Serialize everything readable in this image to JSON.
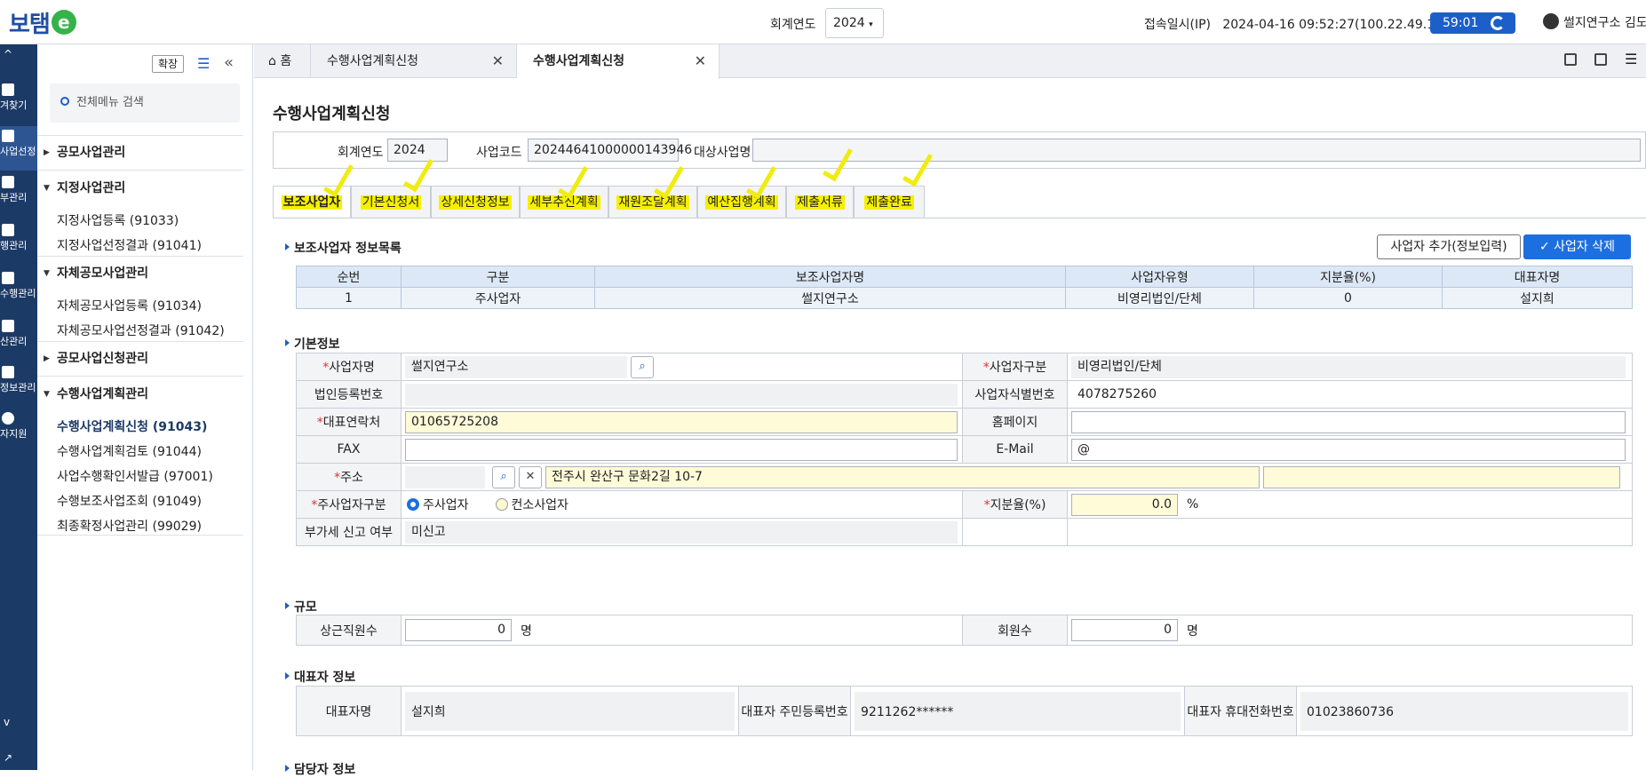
{
  "header": {
    "logo_text": "보탬",
    "logo_e": "e",
    "fiscal_year_label": "회계연도",
    "fiscal_year_value": "2024",
    "connection_info": "접속일시(IP)   2024-04-16 09:52:27(100.22.49.174)",
    "timer": "59:01",
    "user": "썰지연구소 김도"
  },
  "leftnav": {
    "items": [
      {
        "label": "겨찾기"
      },
      {
        "label": "사업선정"
      },
      {
        "label": "부관리"
      },
      {
        "label": "행관리"
      },
      {
        "label": "수행관리"
      },
      {
        "label": "산관리"
      },
      {
        "label": "정보관리"
      },
      {
        "label": "자지원"
      }
    ]
  },
  "sidebar": {
    "expand_label": "확장",
    "search_placeholder": "전체메뉴 검색",
    "groups": [
      {
        "label": "공모사업관리"
      },
      {
        "label": "지정사업관리"
      },
      {
        "label": "자체공모사업관리"
      },
      {
        "label": "공모사업신청관리"
      },
      {
        "label": "수행사업계획관리"
      }
    ],
    "sub_items": [
      {
        "label": "지정사업등록 (91033)"
      },
      {
        "label": "지정사업선정결과 (91041)"
      },
      {
        "label": "자체공모사업등록 (91034)"
      },
      {
        "label": "자체공모사업선정결과 (91042)"
      },
      {
        "label": "수행사업계획신청 (91043)"
      },
      {
        "label": "수행사업계획검토 (91044)"
      },
      {
        "label": "사업수행확인서발급 (97001)"
      },
      {
        "label": "수행보조사업조회 (91049)"
      },
      {
        "label": "최종확정사업관리 (99029)"
      }
    ]
  },
  "tabs": {
    "home": "홈",
    "tab1": "수행사업계획신청",
    "tab2": "수행사업계획신청"
  },
  "page": {
    "title": "수행사업계획신청",
    "filter": {
      "fiscal_year_label": "회계연도",
      "fiscal_year": "2024",
      "biz_code_label": "사업코드",
      "biz_code": "20244641000000143946",
      "target_label": "대상사업명",
      "target": ""
    },
    "steps": [
      "보조사업자",
      "기본신청서",
      "상세신청정보",
      "세부추진계획",
      "재원조달계획",
      "예산집행계획",
      "제출서류",
      "제출완료"
    ]
  },
  "operator_list": {
    "title": "보조사업자 정보목록",
    "add_button": "사업자 추가(정보입력)",
    "delete_button": "사업자 삭제",
    "columns": [
      "순번",
      "구분",
      "보조사업자명",
      "사업자유형",
      "지분율(%)",
      "대표자명"
    ],
    "rows": [
      [
        "1",
        "주사업자",
        "썰지연구소",
        "비영리법인/단체",
        "0",
        "설지희"
      ]
    ]
  },
  "basic_info": {
    "title": "기본정보",
    "biz_name_label": "사업자명",
    "biz_name": "썰지연구소",
    "biz_type_label": "사업자구분",
    "biz_type": "비영리법인/단체",
    "corp_reg_label": "법인등록번호",
    "corp_reg": "",
    "biz_id_label": "사업자식별번호",
    "biz_id": "4078275260",
    "phone_label": "대표연락처",
    "phone": "01065725208",
    "homepage_label": "홈페이지",
    "homepage": "",
    "fax_label": "FAX",
    "fax": "",
    "email_label": "E-Mail",
    "email": "@",
    "address_label": "주소",
    "address_zip": "",
    "address1": "전주시 완산구 문화2길 10-7",
    "address2": "",
    "operator_kind_label": "주사업자구분",
    "operator_main": "주사업자",
    "operator_consortium": "컨소사업자",
    "share_label": "지분율(%)",
    "share": "0.0",
    "share_unit": "%",
    "vat_label": "부가세 신고 여부",
    "vat": "미신고"
  },
  "scale": {
    "title": "규모",
    "staff_label": "상근직원수",
    "staff": "0",
    "staff_unit": "명",
    "members_label": "회원수",
    "members": "0",
    "members_unit": "명"
  },
  "rep_info": {
    "title": "대표자 정보",
    "name_label": "대표자명",
    "name": "설지희",
    "rrn_label": "대표자 주민등록번호",
    "rrn": "9211262******",
    "mobile_label": "대표자 휴대전화번호",
    "mobile": "01023860736"
  },
  "manager_info": {
    "title": "담당자 정보"
  },
  "colors": {
    "nav": "#1c3a66",
    "primary": "#1d6fe0",
    "highlight": "#f6f000"
  }
}
